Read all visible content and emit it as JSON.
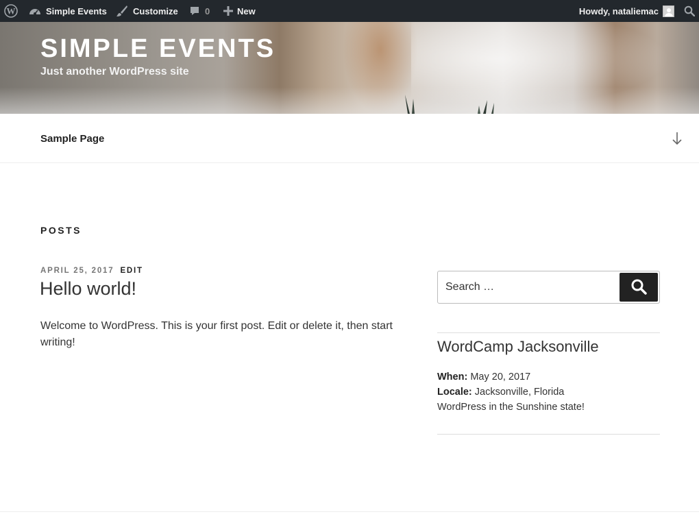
{
  "admin_bar": {
    "site_name": "Simple Events",
    "customize": "Customize",
    "comments_count": "0",
    "new": "New",
    "howdy": "Howdy, nataliemac"
  },
  "header": {
    "site_title": "SIMPLE EVENTS",
    "site_description": "Just another WordPress site"
  },
  "nav": {
    "items": [
      {
        "label": "Sample Page"
      }
    ]
  },
  "main": {
    "section_heading": "POSTS",
    "post": {
      "date": "APRIL 25, 2017",
      "edit_label": "EDIT",
      "title": "Hello world!",
      "excerpt": "Welcome to WordPress. This is your first post. Edit or delete it, then start writing!"
    }
  },
  "sidebar": {
    "search": {
      "placeholder": "Search …"
    },
    "event": {
      "title": "WordCamp Jacksonville",
      "when_label": "When:",
      "when_value": "May 20, 2017",
      "locale_label": "Locale:",
      "locale_value": "Jacksonville, Florida",
      "description": "WordPress in the Sunshine state!"
    }
  },
  "colors": {
    "admin_bar_bg": "#23282d",
    "button_bg": "#222222",
    "text": "#333333"
  },
  "icons": [
    "wordpress-logo-icon",
    "dashboard-icon",
    "brush-icon",
    "comment-icon",
    "plus-icon",
    "avatar-icon",
    "search-icon",
    "arrow-down-icon"
  ]
}
